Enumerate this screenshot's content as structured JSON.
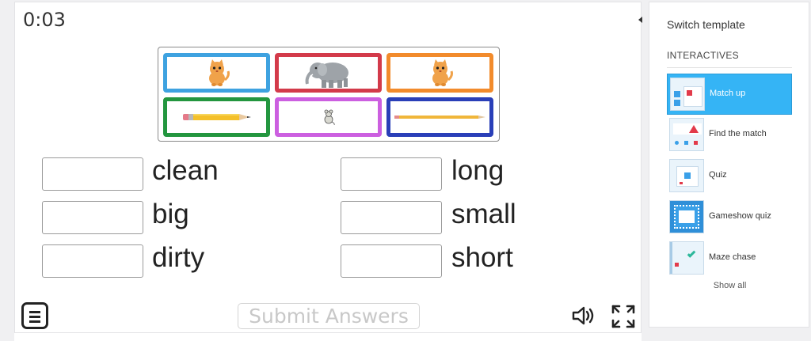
{
  "game": {
    "timer": "0:03",
    "tiles": [
      {
        "name": "cat",
        "border": "#3ea2e0"
      },
      {
        "name": "elephant",
        "border": "#d33a4a"
      },
      {
        "name": "cat",
        "border": "#f28b2c"
      },
      {
        "name": "long-pencil",
        "border": "#23963f"
      },
      {
        "name": "mouse",
        "border": "#cc5fe0"
      },
      {
        "name": "thin-pencil",
        "border": "#2a3fb8"
      }
    ],
    "words": {
      "w1": "clean",
      "w2": "big",
      "w3": "dirty",
      "w4": "long",
      "w5": "small",
      "w6": "short"
    },
    "submit_label": "Submit Answers"
  },
  "sidebar": {
    "title": "Switch template",
    "section": "INTERACTIVES",
    "items": [
      {
        "label": "Match up",
        "active": true
      },
      {
        "label": "Find the match"
      },
      {
        "label": "Quiz"
      },
      {
        "label": "Gameshow quiz"
      },
      {
        "label": "Maze chase"
      }
    ],
    "show_all": "Show all"
  }
}
